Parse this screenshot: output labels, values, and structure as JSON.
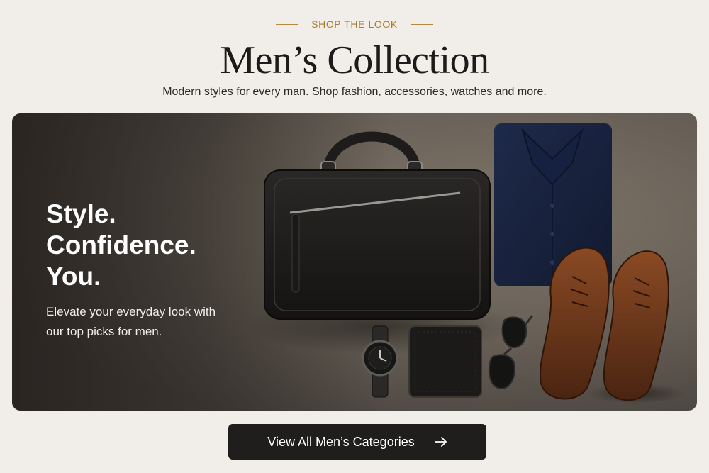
{
  "header": {
    "eyebrow": "SHOP THE LOOK",
    "title": "Men’s Collection",
    "subtitle": "Modern styles for every man. Shop fashion, accessories, watches and more."
  },
  "hero": {
    "headline_lines": [
      "Style.",
      "Confidence.",
      "You."
    ],
    "body": "Elevate your everyday look with our top picks for men.",
    "image_items": [
      "leather-bag",
      "navy-shirt",
      "brown-oxford-shoes",
      "wristwatch",
      "wallet",
      "sunglasses"
    ]
  },
  "cta": {
    "label": "View All Men’s Categories",
    "icon": "arrow-right-icon"
  },
  "colors": {
    "background": "#f1eeea",
    "accent_gold": "#a87b2e",
    "button_bg": "#1f1e1d",
    "title_text": "#1c1b1a"
  }
}
